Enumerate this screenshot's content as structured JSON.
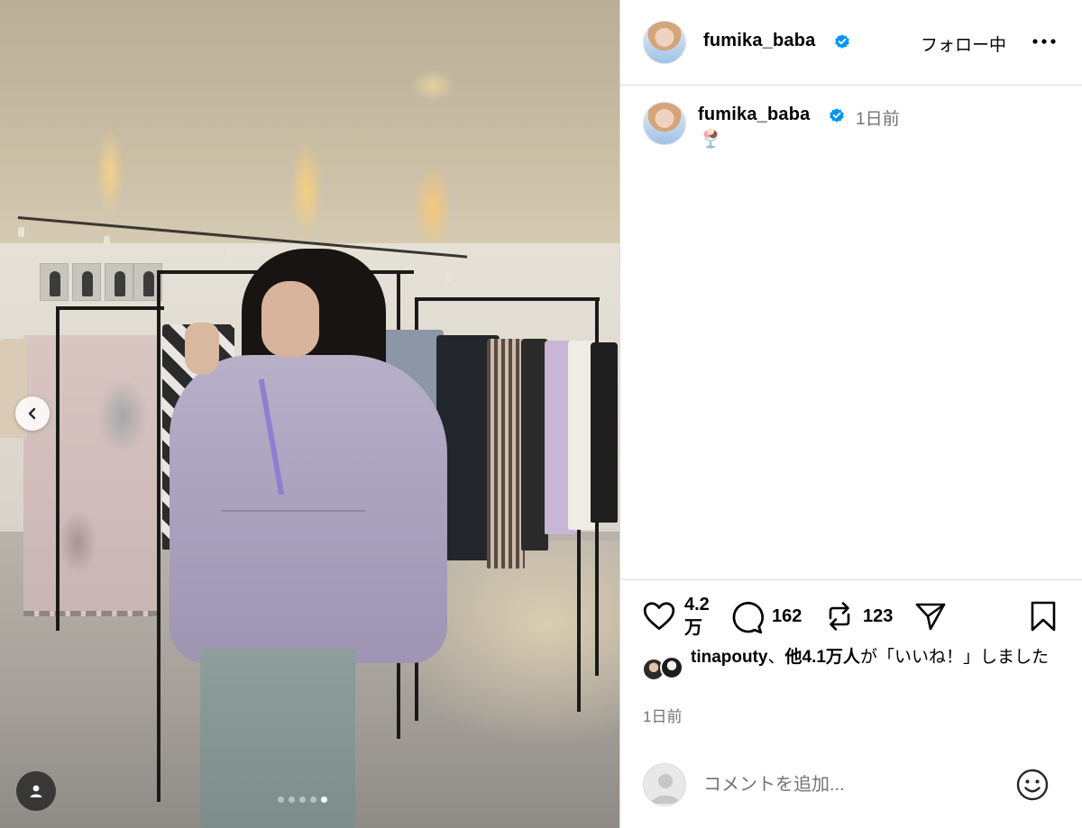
{
  "post": {
    "username": "fumika_baba",
    "verified": true,
    "follow_status": "フォロー中",
    "caption_time": "1日前",
    "caption_emoji": "🍨",
    "carousel": {
      "slide_count": 5,
      "active_slide": 5
    }
  },
  "actions": {
    "likes_count": "4.2\n万",
    "comments_count": "162",
    "reposts_count": "123"
  },
  "likes_summary": {
    "user": "tinapouty",
    "middle": "、",
    "others": "他4.1万人",
    "suffix": "が「いいね！」しました"
  },
  "post_time": "1日前",
  "comment": {
    "placeholder": "コメントを追加..."
  },
  "icons": {
    "verified": "verified-badge-icon",
    "more": "more-horizontal-icon",
    "like": "heart-icon",
    "comment": "comment-icon",
    "repost": "repost-icon",
    "share": "paper-plane-icon",
    "save": "bookmark-icon",
    "emoji": "smiley-icon",
    "prev": "chevron-left-icon",
    "tagged": "user-icon"
  },
  "colors": {
    "verified_blue": "#0095f6",
    "muted_text": "#737373",
    "divider": "#dbdbdb"
  }
}
